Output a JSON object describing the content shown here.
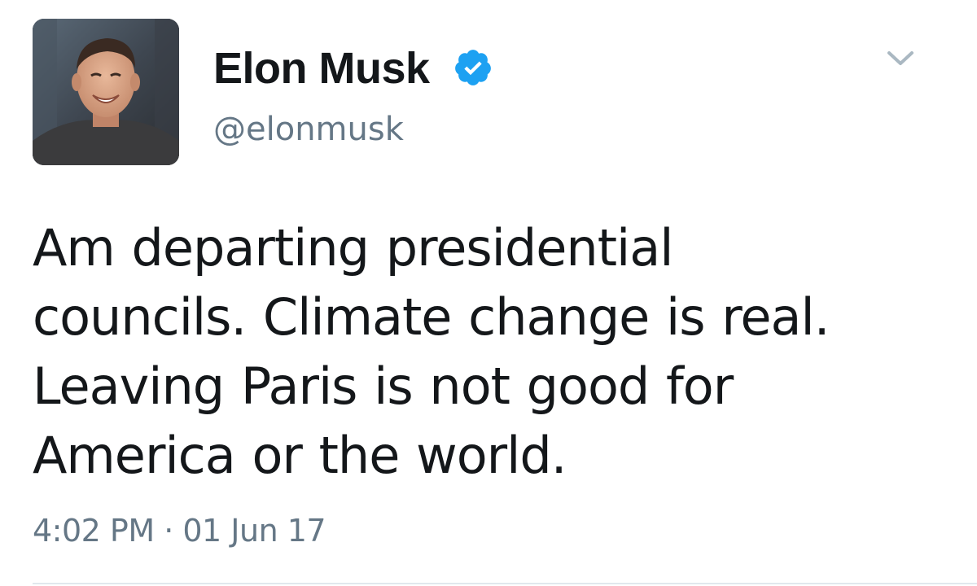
{
  "tweet": {
    "display_name": "Elon Musk",
    "handle": "@elonmusk",
    "verified": true,
    "text_lines": [
      "Am departing presidential",
      "councils. Climate change is real.",
      "Leaving Paris is not good for",
      "America or the world."
    ],
    "timestamp": "4:02 PM · 01 Jun 17"
  },
  "icons": {
    "verified": "verified-badge-icon",
    "menu": "chevron-down-icon"
  },
  "colors": {
    "verified_blue": "#1da1f2",
    "secondary_text": "#657786",
    "primary_text": "#14171a",
    "divider": "#e1e8ed"
  }
}
